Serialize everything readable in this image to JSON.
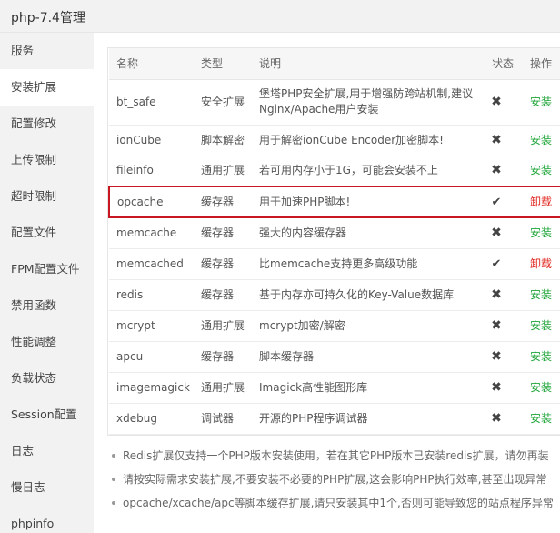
{
  "header": {
    "title": "php-7.4管理"
  },
  "sidebar": {
    "items": [
      {
        "label": "服务"
      },
      {
        "label": "安装扩展"
      },
      {
        "label": "配置修改"
      },
      {
        "label": "上传限制"
      },
      {
        "label": "超时限制"
      },
      {
        "label": "配置文件"
      },
      {
        "label": "FPM配置文件"
      },
      {
        "label": "禁用函数"
      },
      {
        "label": "性能调整"
      },
      {
        "label": "负载状态"
      },
      {
        "label": "Session配置"
      },
      {
        "label": "日志"
      },
      {
        "label": "慢日志"
      },
      {
        "label": "phpinfo"
      }
    ],
    "active_index": 1
  },
  "table": {
    "headers": {
      "name": "名称",
      "type": "类型",
      "desc": "说明",
      "status": "状态",
      "action": "操作"
    },
    "rows": [
      {
        "name": "bt_safe",
        "type": "安全扩展",
        "desc": "堡塔PHP安全扩展,用于增强防跨站机制,建议Nginx/Apache用户安装",
        "installed": false,
        "action": "安装"
      },
      {
        "name": "ionCube",
        "type": "脚本解密",
        "desc": "用于解密ionCube Encoder加密脚本!",
        "installed": false,
        "action": "安装"
      },
      {
        "name": "fileinfo",
        "type": "通用扩展",
        "desc": "若可用内存小于1G，可能会安装不上",
        "installed": false,
        "action": "安装"
      },
      {
        "name": "opcache",
        "type": "缓存器",
        "desc": "用于加速PHP脚本!",
        "installed": true,
        "action": "卸载"
      },
      {
        "name": "memcache",
        "type": "缓存器",
        "desc": "强大的内容缓存器",
        "installed": false,
        "action": "安装"
      },
      {
        "name": "memcached",
        "type": "缓存器",
        "desc": "比memcache支持更多高级功能",
        "installed": true,
        "action": "卸载"
      },
      {
        "name": "redis",
        "type": "缓存器",
        "desc": "基于内存亦可持久化的Key-Value数据库",
        "installed": false,
        "action": "安装"
      },
      {
        "name": "mcrypt",
        "type": "通用扩展",
        "desc": "mcrypt加密/解密",
        "installed": false,
        "action": "安装"
      },
      {
        "name": "apcu",
        "type": "缓存器",
        "desc": "脚本缓存器",
        "installed": false,
        "action": "安装"
      },
      {
        "name": "imagemagick",
        "type": "通用扩展",
        "desc": "Imagick高性能图形库",
        "installed": false,
        "action": "安装"
      },
      {
        "name": "xdebug",
        "type": "调试器",
        "desc": "开源的PHP程序调试器",
        "installed": false,
        "action": "安装"
      }
    ]
  },
  "notes": [
    "Redis扩展仅支持一个PHP版本安装使用，若在其它PHP版本已安装redis扩展，请勿再装",
    "请按实际需求安装扩展,不要安装不必要的PHP扩展,这会影响PHP执行效率,甚至出现异常",
    "opcache/xcache/apc等脚本缓存扩展,请只安装其中1个,否则可能导致您的站点程序异常"
  ],
  "colors": {
    "install": "#20a53a",
    "uninstall": "#e0251e",
    "highlight_border": "#c81623"
  },
  "icons": {
    "not_installed": "close-icon",
    "installed": "check-icon"
  }
}
